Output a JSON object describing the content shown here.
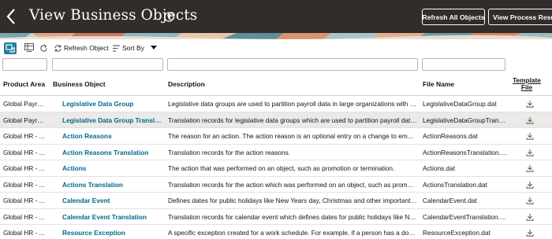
{
  "header": {
    "title": "View Business Objects",
    "refresh_all_label": "Refresh All Objects",
    "view_process_label": "View Process Results"
  },
  "toolbar": {
    "refresh_label": "Refresh Object",
    "sort_label": "Sort By"
  },
  "table": {
    "columns": {
      "product_area": "Product Area",
      "business_object": "Business Object",
      "description": "Description",
      "file_name": "File Name",
      "template_file": "Template File"
    },
    "rows": [
      {
        "area": "Global Payroll...",
        "object": "Legislative Data Group",
        "description": "Legislative data groups are used to partition payroll data in large organizations with mult...",
        "file": "LegislativeDataGroup.dat"
      },
      {
        "area": "Global Payroll...",
        "object": "Legislative Data Group Translation",
        "description": "Translation records for legislative data groups which are used to partition payroll data in...",
        "file": "LegislativeDataGroupTransl..."
      },
      {
        "area": "Global HR - ...",
        "object": "Action Reasons",
        "description": "The reason for an action. The action reason is an optional entry on a change to employ...",
        "file": "ActionReasons.dat"
      },
      {
        "area": "Global HR - ...",
        "object": "Action Reasons Translation",
        "description": "Translation records for the action reasons.",
        "file": "ActionReasonsTranslation.dat"
      },
      {
        "area": "Global HR - ...",
        "object": "Actions",
        "description": "The action that was performed on an object, such as promotion or termination.",
        "file": "Actions.dat"
      },
      {
        "area": "Global HR - ...",
        "object": "Actions Translation",
        "description": "Translation records for the action which was performed on an object, such as promotion...",
        "file": "ActionsTranslation.dat"
      },
      {
        "area": "Global HR - ...",
        "object": "Calendar Event",
        "description": "Defines dates for public holidays like New Years day, Christmas and other important ev...",
        "file": "CalendarEvent.dat"
      },
      {
        "area": "Global HR - ...",
        "object": "Calendar Event Translation",
        "description": "Translation records for calendar event which defines dates for public holidays like New ...",
        "file": "CalendarEventTranslation.dat"
      },
      {
        "area": "Global HR - ...",
        "object": "Resource Exception",
        "description": "A specific exception created for a work schedule. For example, if a person has a doctor ...",
        "file": "ResourceException.dat"
      }
    ],
    "selected_row": 1
  },
  "icons": {
    "back": "chevron-left-icon",
    "help": "help-circle-icon",
    "detach": "detach-table-icon",
    "freeze": "freeze-columns-icon",
    "refresh": "refresh-icon",
    "refresh_object": "refresh-object-icon",
    "sort": "sort-icon",
    "sort_dropdown": "caret-down-icon",
    "download": "download-icon"
  },
  "colors": {
    "header_bg": "#312d2a",
    "link": "#00688c",
    "selected_row": "#ebeae8",
    "accent": "#227e9e"
  }
}
